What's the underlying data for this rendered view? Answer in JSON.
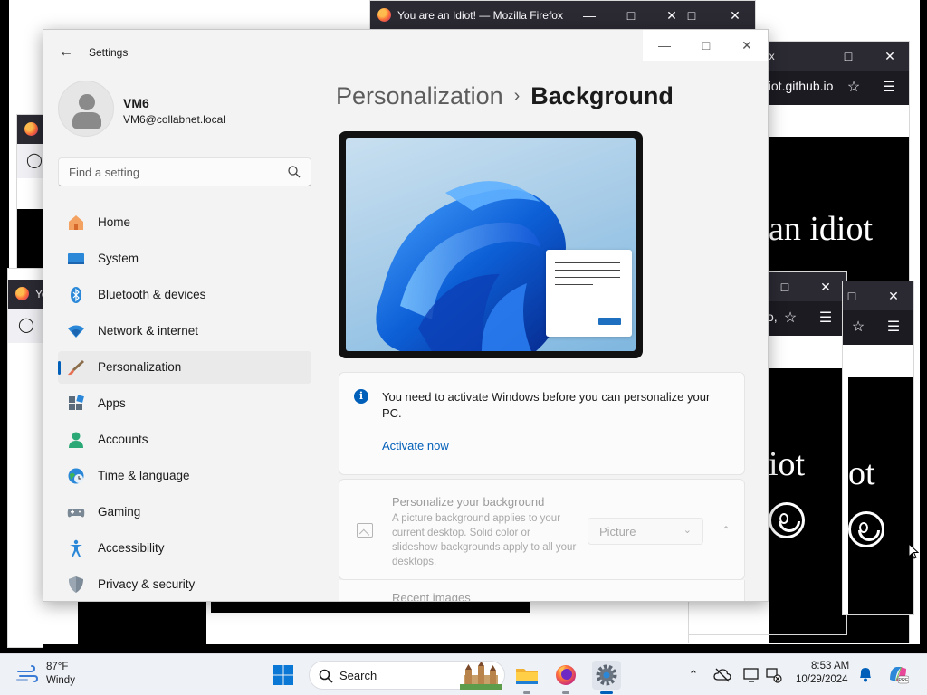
{
  "firefox_windows": {
    "top_title": "You are an Idiot! — Mozilla Firefox",
    "url_fragment_right": "diot.github.io",
    "url_fragment_lower": "o,",
    "page_text_1": "an idiot",
    "page_text_2": "iot",
    "page_text_3": "ot",
    "partial_title_1": "ox",
    "partial_title_2": "Yo"
  },
  "settings": {
    "app_title": "Settings",
    "user": {
      "name": "VM6",
      "email": "VM6@collabnet.local"
    },
    "search": {
      "placeholder": "Find a setting"
    },
    "nav": [
      {
        "label": "Home",
        "icon": "home-icon"
      },
      {
        "label": "System",
        "icon": "system-icon"
      },
      {
        "label": "Bluetooth & devices",
        "icon": "bluetooth-icon"
      },
      {
        "label": "Network & internet",
        "icon": "network-icon"
      },
      {
        "label": "Personalization",
        "icon": "brush-icon",
        "active": true
      },
      {
        "label": "Apps",
        "icon": "apps-icon"
      },
      {
        "label": "Accounts",
        "icon": "accounts-icon"
      },
      {
        "label": "Time & language",
        "icon": "globe-clock-icon"
      },
      {
        "label": "Gaming",
        "icon": "gamepad-icon"
      },
      {
        "label": "Accessibility",
        "icon": "accessibility-icon"
      },
      {
        "label": "Privacy & security",
        "icon": "shield-icon"
      }
    ],
    "breadcrumb": {
      "parent": "Personalization",
      "separator": "›",
      "current": "Background"
    },
    "activation": {
      "message": "You need to activate Windows before you can personalize your PC.",
      "link": "Activate now"
    },
    "background": {
      "title": "Personalize your background",
      "description": "A picture background applies to your current desktop. Solid color or slideshow backgrounds apply to all your desktops.",
      "dropdown_value": "Picture",
      "recent_images_label": "Recent images"
    },
    "colors": {
      "accent": "#005fb8"
    }
  },
  "taskbar": {
    "weather": {
      "temp": "87°F",
      "condition": "Windy"
    },
    "search_placeholder": "Search",
    "time": "8:53 AM",
    "date": "10/29/2024"
  }
}
